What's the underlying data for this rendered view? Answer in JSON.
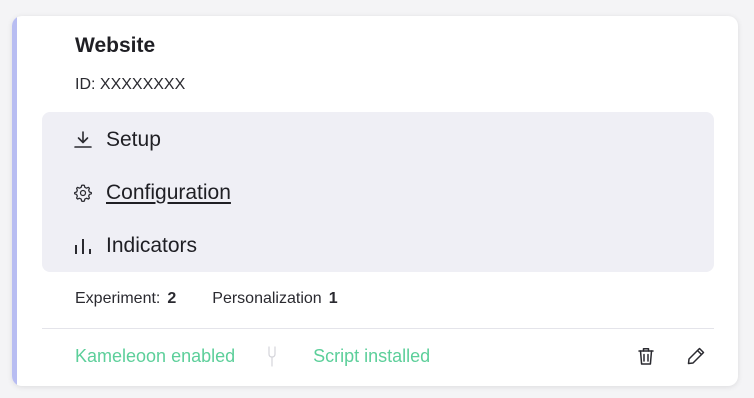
{
  "site": {
    "title": "Website",
    "id_text": "ID: XXXXXXXX"
  },
  "menu": {
    "items": [
      {
        "label": "Setup",
        "icon": "download-icon",
        "active": false
      },
      {
        "label": "Configuration",
        "icon": "gear-icon",
        "active": true
      },
      {
        "label": "Indicators",
        "icon": "bar-chart-icon",
        "active": false
      }
    ]
  },
  "stats": {
    "experiment_label": "Experiment:",
    "experiment_value": "2",
    "personalization_label": "Personalization",
    "personalization_value": "1"
  },
  "footer": {
    "kameleoon_status": "Kameleoon enabled",
    "script_status": "Script installed",
    "separator_icon": "tuning-fork-icon"
  },
  "actions": {
    "delete_icon": "trash-icon",
    "edit_icon": "pencil-icon"
  },
  "colors": {
    "accent": "#b8bdf2",
    "status_green": "#5ccf9a",
    "menu_bg": "#efeff5"
  }
}
